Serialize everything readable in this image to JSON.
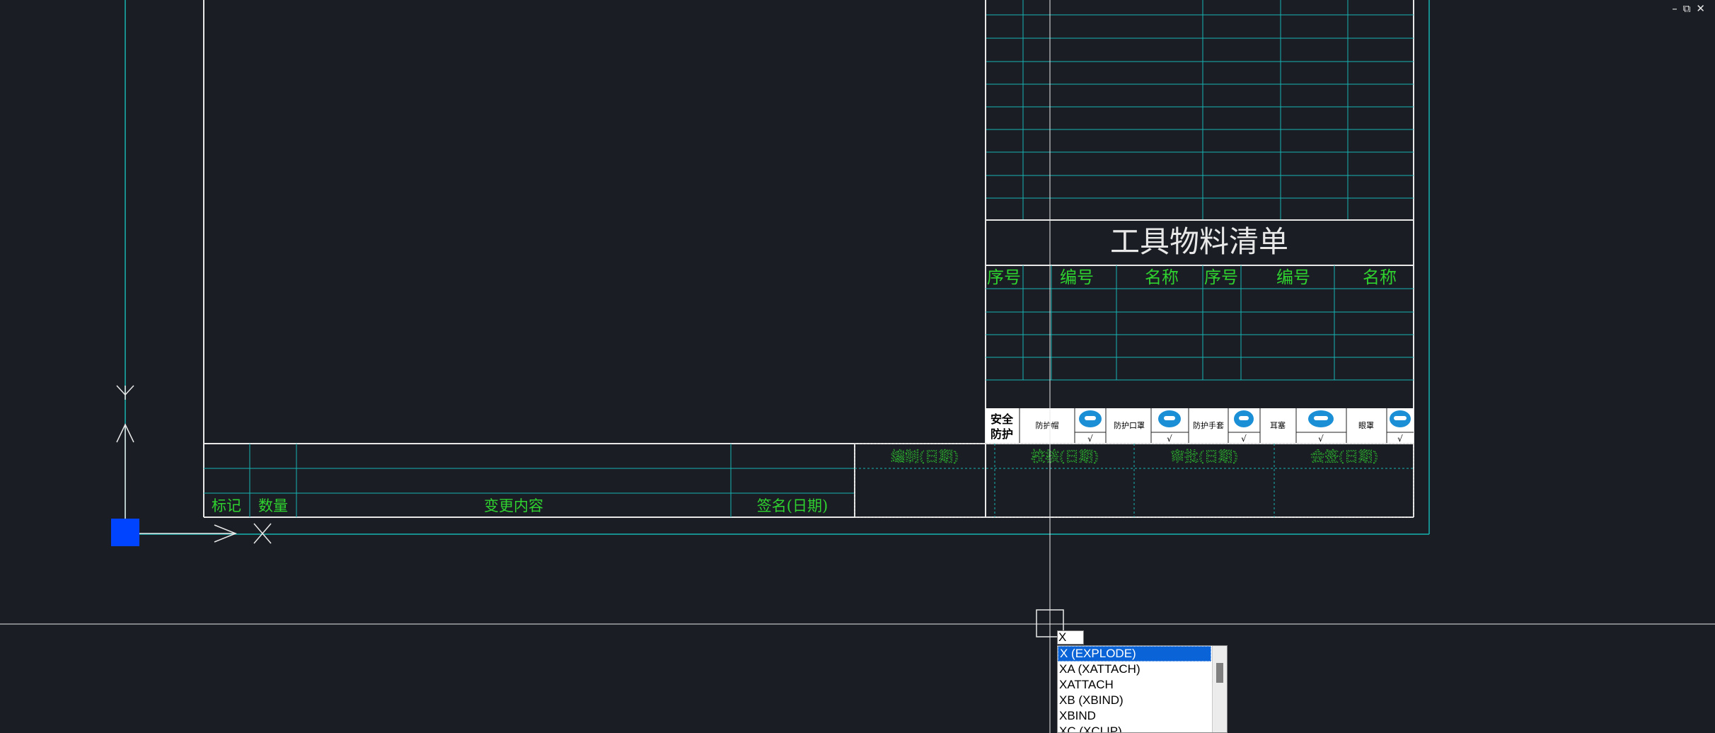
{
  "window_controls": {
    "minimize": "–",
    "restore": "⧉",
    "close": "✕"
  },
  "drawing": {
    "title_block": {
      "title": "工具物料清单",
      "headers": [
        "序号",
        "编号",
        "名称",
        "序号",
        "编号",
        "名称"
      ],
      "safety_label_line1": "安全",
      "safety_label_line2": "防护",
      "safety_items": [
        "防护帽",
        "防护口罩",
        "防护手套",
        "耳塞",
        "眼罩"
      ],
      "check_mark": "√",
      "signature_headers": [
        "编制(日期)",
        "校核(日期)",
        "审批(日期)",
        "会签(日期)"
      ]
    },
    "revision_table": {
      "headers": [
        "标记",
        "数量",
        "变更内容",
        "签名(日期)"
      ]
    }
  },
  "colors": {
    "background": "#1a1e24",
    "frame_white": "#e8e8e8",
    "grid_cyan": "#18b2b2",
    "text_green": "#2fd12f",
    "ucs_square": "#0044ff",
    "icon_blue": "#1a8fd6"
  },
  "command_line": {
    "input_value": "X",
    "suggestions": [
      "X (EXPLODE)",
      "XA (XATTACH)",
      "XATTACH",
      "XB (XBIND)",
      "XBIND",
      "XC (XCLIP)"
    ]
  }
}
